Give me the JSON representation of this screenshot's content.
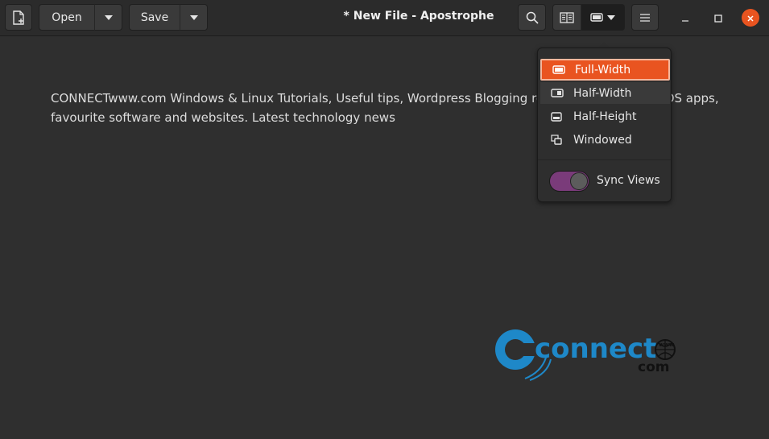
{
  "window": {
    "title": "* New File - Apostrophe"
  },
  "toolbar": {
    "new_file_icon": "new-document-icon",
    "open_label": "Open",
    "save_label": "Save",
    "search_icon": "search-icon",
    "preview_icon": "preview-book-icon",
    "layout_icon": "preview-layout-icon",
    "menu_icon": "hamburger-menu-icon"
  },
  "window_controls": {
    "minimize": "minimize-icon",
    "maximize": "maximize-icon",
    "close": "close-icon"
  },
  "editor": {
    "text": "CONNECTwww.com Windows & Linux Tutorials, Useful tips, Wordpress Blogging resources, Android & iOS apps, favourite software and websites. Latest technology news"
  },
  "preview_menu": {
    "items": [
      {
        "label": "Full-Width",
        "icon": "full-width-icon",
        "selected": true
      },
      {
        "label": "Half-Width",
        "icon": "half-width-icon",
        "selected": false
      },
      {
        "label": "Half-Height",
        "icon": "half-height-icon",
        "selected": false
      },
      {
        "label": "Windowed",
        "icon": "windowed-icon",
        "selected": false
      }
    ],
    "sync_label": "Sync Views",
    "sync_enabled": true
  },
  "watermark": {
    "brand": "connect",
    "suffix": "com",
    "www": "www"
  },
  "colors": {
    "accent": "#e95420",
    "toggle_on": "#7a3b7a",
    "watermark_blue": "#1e88c8"
  }
}
